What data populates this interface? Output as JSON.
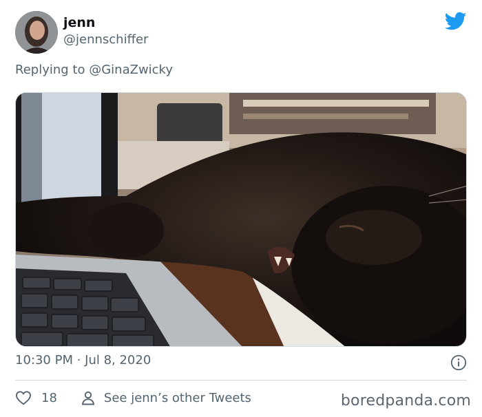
{
  "tweet": {
    "author_name": "jenn",
    "author_handle": "@jennschiffer",
    "reply_prefix": "Replying to",
    "reply_to": "@GinaZwicky",
    "timestamp": "10:30 PM · Jul 8, 2020",
    "likes": "18",
    "other_tweets_link": "See jenn’s other Tweets"
  },
  "icons": {
    "brand": "twitter-bird-icon",
    "info": "info-icon",
    "like": "heart-icon",
    "profile": "person-icon"
  },
  "colors": {
    "twitter_blue": "#1d9bf0",
    "secondary_text": "#536471",
    "divider": "#cfd9de"
  },
  "watermark": "boredpanda.com"
}
